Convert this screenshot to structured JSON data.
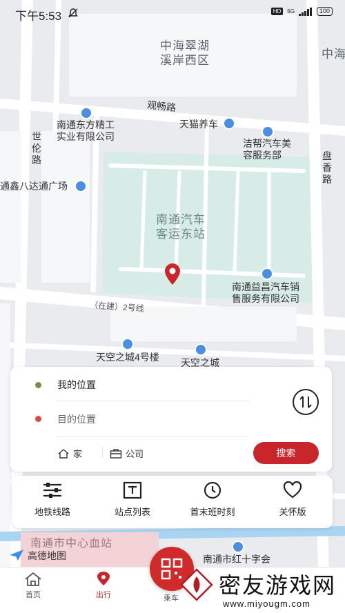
{
  "status_bar": {
    "time": "下午5:53",
    "network": "5G",
    "battery": "100"
  },
  "map": {
    "labels": {
      "district": "中海翠湖\n溪岸西区",
      "district_edge": "中海",
      "road_guanchang": "观畅路",
      "road_shilun": "世\n伦\n路",
      "road_panxiang": "盘\n香\n路",
      "poi_dongfang": "南通东方精工\n实业有限公司",
      "poi_tianmao": "天猫养车",
      "poi_jiebang": "洁帮汽车美\n容服务部",
      "poi_tongxin": "通鑫八达通广场",
      "station": "南通汽车\n客运东站",
      "poi_yichang": "南通益昌汽车销\n售服务有限公司",
      "metro_line": "（在建）2号线",
      "poi_tiankong4": "天空之城4号楼",
      "poi_tiankong": "天空之城",
      "poi_blood": "南通市中心血站",
      "poi_redcross": "南通市红十字会",
      "logo": "高德地图"
    }
  },
  "route_panel": {
    "origin": "我的位置",
    "destination": "目的位置",
    "shortcut_home": "家",
    "shortcut_company": "公司",
    "search_button": "搜索",
    "origin_color": "#7a8a4a",
    "destination_color": "#d84a4a"
  },
  "quick_actions": [
    {
      "label": "地铁线路",
      "icon": "sliders-icon"
    },
    {
      "label": "站点列表",
      "icon": "station-list-icon"
    },
    {
      "label": "首末班时刻",
      "icon": "clock-icon"
    },
    {
      "label": "关怀版",
      "icon": "heart-icon"
    }
  ],
  "bottom_nav": {
    "home": "首页",
    "travel": "出行",
    "ride": "乘车"
  },
  "watermark": {
    "name": "密友游戏网",
    "url": "www.miyougm.com"
  },
  "colors": {
    "accent": "#c8262a",
    "map_bg": "#e9ebee",
    "station_area": "#d7ece6",
    "poi_blue": "#4a8fe0"
  }
}
